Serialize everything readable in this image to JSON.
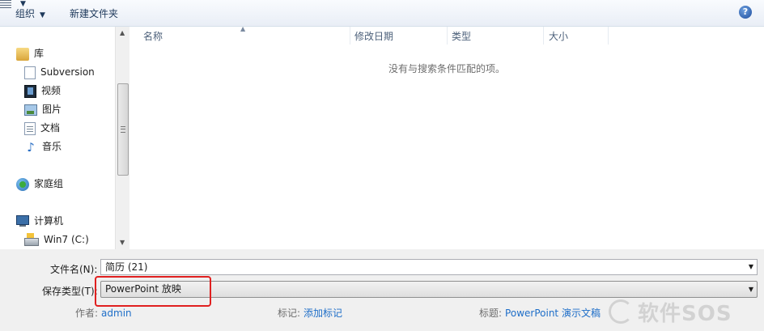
{
  "toolbar": {
    "organize_label": "组织",
    "new_folder_label": "新建文件夹",
    "view_icon": "view-list-icon",
    "help_label": "?"
  },
  "nav": {
    "items": [
      {
        "label": "库",
        "icon": "library-icon"
      },
      {
        "label": "Subversion",
        "icon": "document-icon"
      },
      {
        "label": "视频",
        "icon": "video-icon"
      },
      {
        "label": "图片",
        "icon": "picture-icon"
      },
      {
        "label": "文档",
        "icon": "document-icon"
      },
      {
        "label": "音乐",
        "icon": "music-icon"
      },
      {
        "label": "家庭组",
        "icon": "homegroup-icon"
      },
      {
        "label": "计算机",
        "icon": "computer-icon"
      },
      {
        "label": "Win7 (C:)",
        "icon": "drive-icon"
      }
    ],
    "music_glyph": "♪"
  },
  "content": {
    "columns": [
      "名称",
      "修改日期",
      "类型",
      "大小"
    ],
    "empty_message": "没有与搜索条件匹配的项。"
  },
  "form": {
    "filename_label": "文件名(N):",
    "filename_value": "简历 (21)",
    "savetype_label": "保存类型(T):",
    "savetype_value": "PowerPoint 放映",
    "author_key": "作者:",
    "author_value": "admin",
    "tags_key": "标记:",
    "tags_value": "添加标记",
    "title_key": "标题:",
    "title_value": "PowerPoint 演示文稿"
  },
  "watermark": {
    "text": "软件SOS"
  },
  "colors": {
    "link": "#1e6ec8",
    "highlight": "#e02020",
    "toolbar_text": "#1e395b"
  }
}
